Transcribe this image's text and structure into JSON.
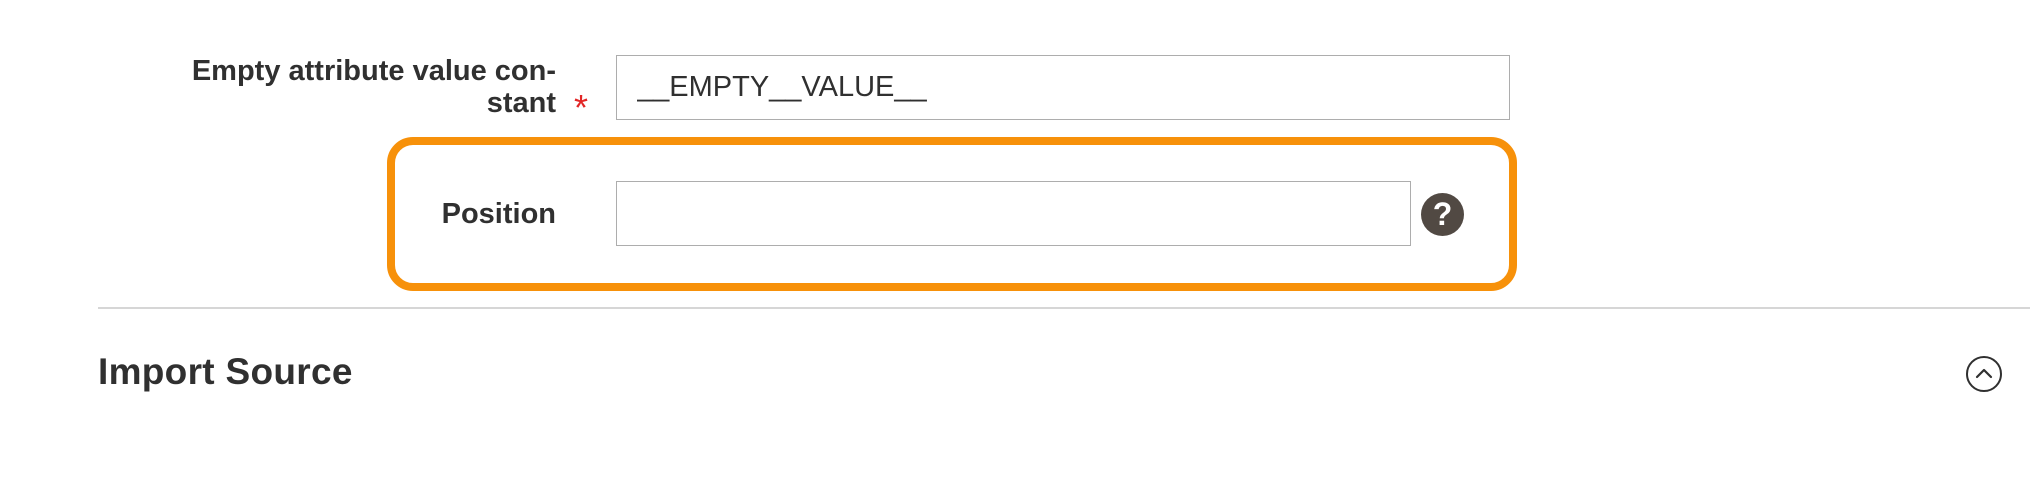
{
  "fields": {
    "empty_attribute": {
      "label": "Empty attribute value con-stant",
      "label_line1": "Empty attribute value con-",
      "label_line2": "stant",
      "required_marker": "*",
      "value": "__EMPTY__VALUE__"
    },
    "position": {
      "label": "Position",
      "value": "",
      "help_icon_glyph": "?"
    }
  },
  "section": {
    "title": "Import Source",
    "state": "expanded"
  },
  "icons": {
    "help": "question-circle-icon",
    "collapse": "chevron-up-circle-icon"
  },
  "colors": {
    "highlight": "#f7910a",
    "required": "#e22626",
    "help_icon_bg": "#514943",
    "text": "#303030",
    "divider": "#d6d6d6"
  }
}
